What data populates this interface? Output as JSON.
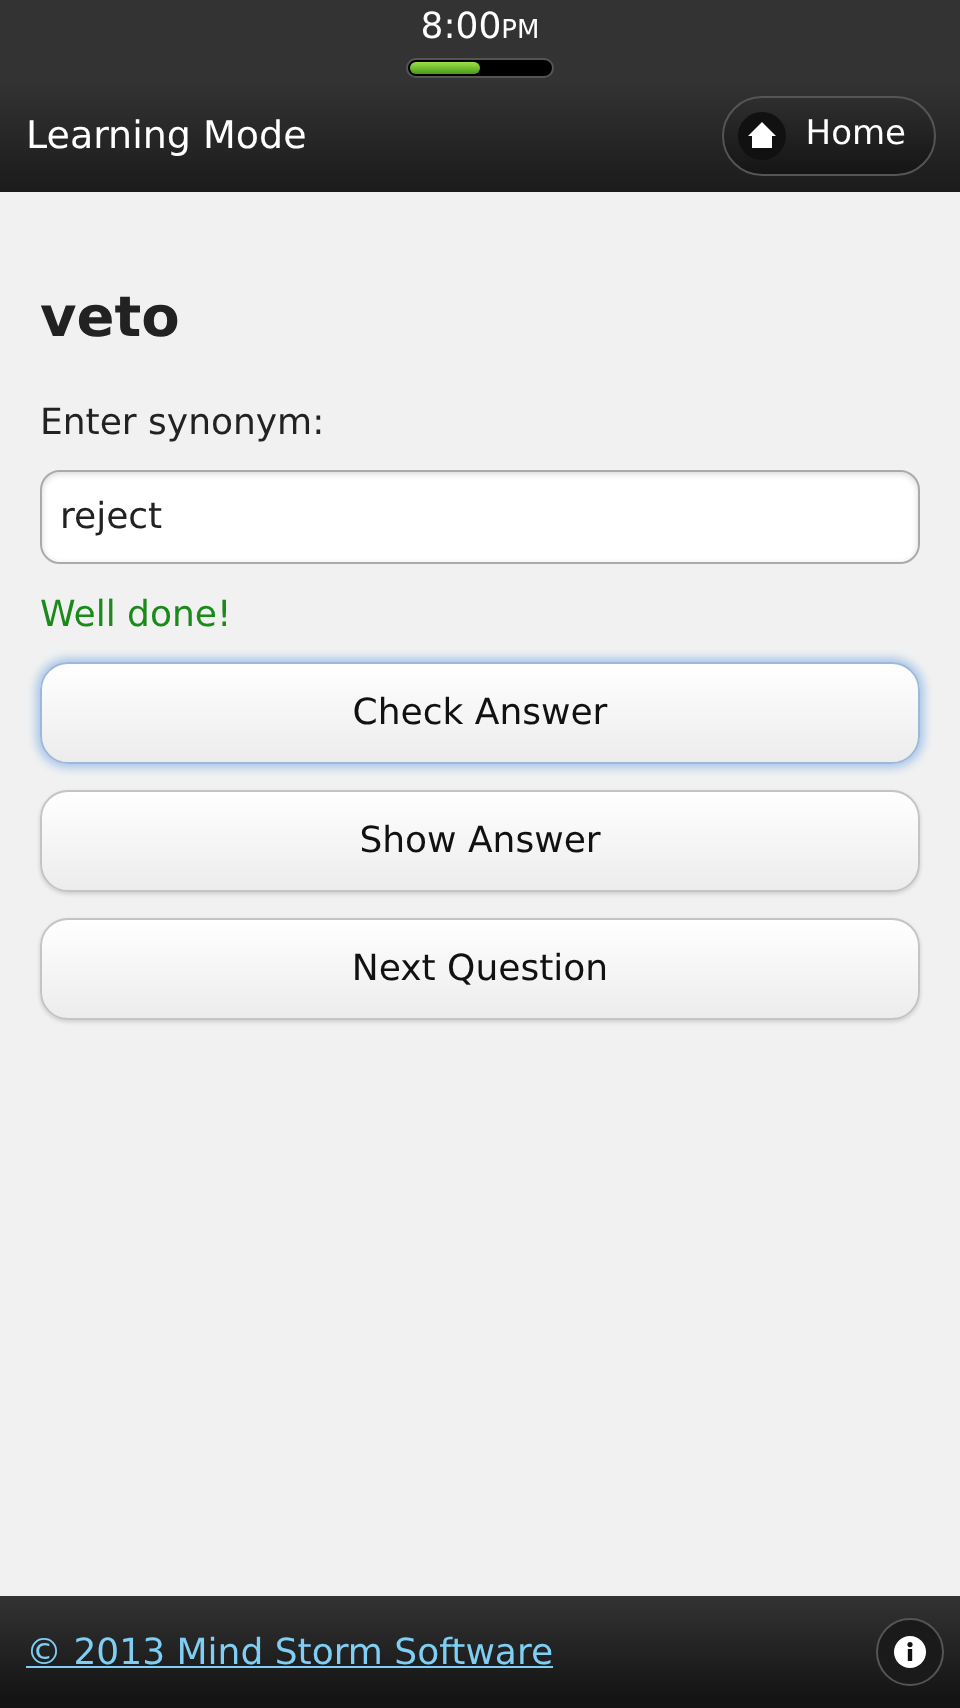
{
  "status_bar": {
    "time": "8:00",
    "meridiem": "PM"
  },
  "header": {
    "title": "Learning Mode",
    "home_button": "Home"
  },
  "quiz": {
    "word": "veto",
    "prompt": "Enter synonym:",
    "answer": "reject",
    "feedback": {
      "text": "Well done!",
      "kind": "success"
    }
  },
  "buttons": [
    {
      "label": "Check Answer",
      "focused": true
    },
    {
      "label": "Show Answer",
      "focused": false
    },
    {
      "label": "Next Question",
      "focused": false
    }
  ],
  "footer": {
    "copyright": "© 2013 Mind Storm Software"
  }
}
